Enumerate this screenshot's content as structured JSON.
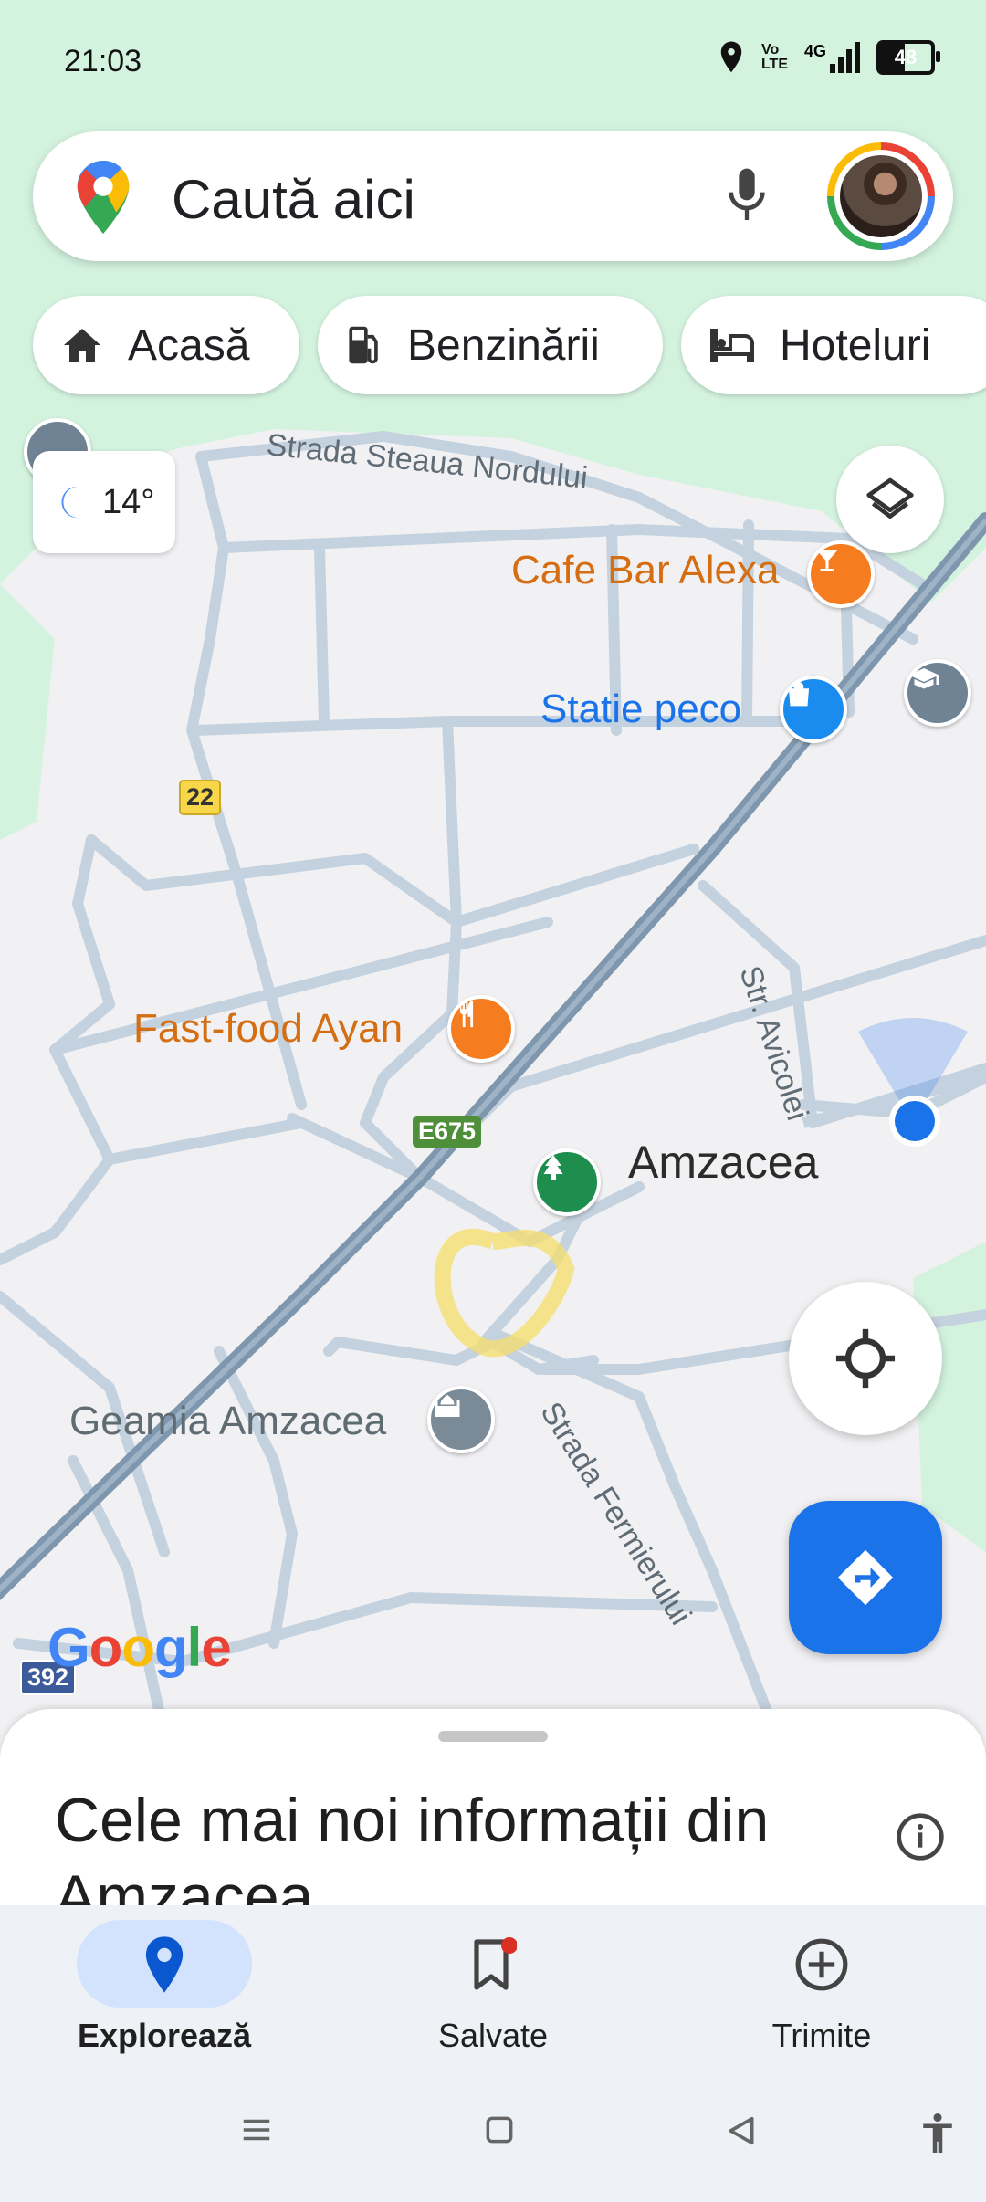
{
  "status_bar": {
    "time": "21:03",
    "network_label": "4G",
    "volte_label": "Vo\nLTE",
    "battery": "48"
  },
  "search": {
    "placeholder": "Caută aici"
  },
  "chips": [
    {
      "label": "Acasă",
      "icon": "home-icon"
    },
    {
      "label": "Benzinării",
      "icon": "gas-station-icon"
    },
    {
      "label": "Hoteluri",
      "icon": "hotel-bed-icon"
    }
  ],
  "weather": {
    "temp": "14°",
    "icon": "moon-icon"
  },
  "map": {
    "pois": [
      {
        "name": "Cafe Bar Alexa",
        "type": "cafe"
      },
      {
        "name": "Statie peco",
        "type": "shop"
      },
      {
        "name": "Fast-food Ayan",
        "type": "restaurant"
      },
      {
        "name": "Amzacea",
        "type": "town"
      },
      {
        "name": "Geamia Amzacea",
        "type": "mosque"
      }
    ],
    "streets": [
      "Strada Steaua Nordului",
      "Str. Avicolei",
      "Strada Fermierului"
    ],
    "route_shields": [
      "22",
      "E675",
      "392"
    ],
    "attribution": "Google",
    "colors": {
      "land": "#f1f1f3",
      "park": "#d3f3df",
      "road": "#c4d2df",
      "highway": "#7f97ae",
      "my_location": "#1a73e8"
    }
  },
  "sheet": {
    "title": "Cele mai noi informații din Amzacea"
  },
  "nav": {
    "items": [
      {
        "label": "Explorează",
        "icon": "explore-pin-icon",
        "active": true
      },
      {
        "label": "Salvate",
        "icon": "bookmark-icon",
        "active": false
      },
      {
        "label": "Trimite",
        "icon": "plus-circle-icon",
        "active": false
      }
    ]
  }
}
